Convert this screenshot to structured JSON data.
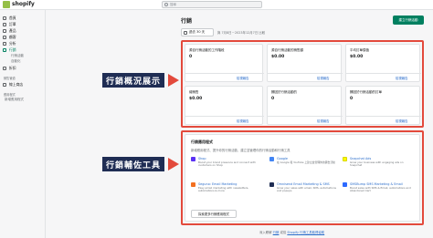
{
  "topbar": {
    "brand": "shopify",
    "search_placeholder": "搜尋"
  },
  "sidebar": {
    "items": [
      {
        "label": "首頁",
        "icon": "home-icon"
      },
      {
        "label": "訂單",
        "icon": "orders-icon"
      },
      {
        "label": "產品",
        "icon": "products-icon"
      },
      {
        "label": "顧客",
        "icon": "customers-icon"
      },
      {
        "label": "分析",
        "icon": "analytics-icon"
      },
      {
        "label": "行銷",
        "icon": "marketing-icon",
        "active": true
      }
    ],
    "sub_items": [
      "行銷活動",
      "自動化"
    ],
    "discount": {
      "label": "折扣",
      "icon": "discount-icon"
    },
    "section_channels": "銷售管道",
    "online_store": {
      "label": "線上商店",
      "icon": "store-icon"
    },
    "section_apps": "應用程式",
    "add_app": "新增應用程式"
  },
  "header": {
    "title": "行銷",
    "primary_button": "建立行銷活動",
    "date_range": "過去 30 天",
    "compare_text": "與 7月8日－2023年12月7日 比較"
  },
  "metrics": [
    {
      "label": "源自行銷活動的工作階段",
      "value": "0",
      "link": "檢視報告"
    },
    {
      "label": "源自行銷活動的銷售額",
      "value": "$0.00",
      "link": "檢視報告"
    },
    {
      "label": "平均訂單價值",
      "value": "$0.00",
      "link": "檢視報告"
    },
    {
      "label": "總銷售",
      "value": "$0.00",
      "link": "檢視報告"
    },
    {
      "label": "歸因於行銷活動的",
      "value": "0",
      "link": "檢視報告"
    },
    {
      "label": "歸因於行銷活動的訂單",
      "value": "0",
      "link": "檢視報告"
    }
  ],
  "callouts": {
    "overview": "行銷概況展示",
    "tools": "行銷輔佐工具"
  },
  "tools": {
    "title": "行銷應用程式",
    "description": "新增應用程式、提升你的行銷活動、建立並管理你的行銷活動和行銷工具",
    "apps": [
      {
        "name": "Shop",
        "desc": "Boost your brand presence and connect with customers on Shop",
        "color": "#5a31f4"
      },
      {
        "name": "Google",
        "desc": "在 Google 和 YouTube 上建立並管理你的廣告活動",
        "color": "#4285f4"
      },
      {
        "name": "Snapchat Ads",
        "desc": "Grow your business with engaging ads on Snapchat",
        "color": "#fffc00"
      },
      {
        "name": "Seguno: Email Marketing",
        "desc": "Easy email marketing with newsletters, automations & more",
        "color": "#f37021"
      },
      {
        "name": "Omnisend Email Marketing & SMS",
        "desc": "Grow your sales with email, SMS, automations and popups",
        "color": "#1f2d54"
      },
      {
        "name": "SMSBump SMS Marketing & Email",
        "desc": "Boost sales with SMS & Email, automations and Abandoned Cart",
        "color": "#2d6aff"
      }
    ],
    "more_button": "探索更多行銷應用程式"
  },
  "footer": {
    "prefix": "深入瞭解",
    "link1": "行銷",
    "middle": "或從",
    "link2": "Shopify 行銷工具取得協助"
  }
}
